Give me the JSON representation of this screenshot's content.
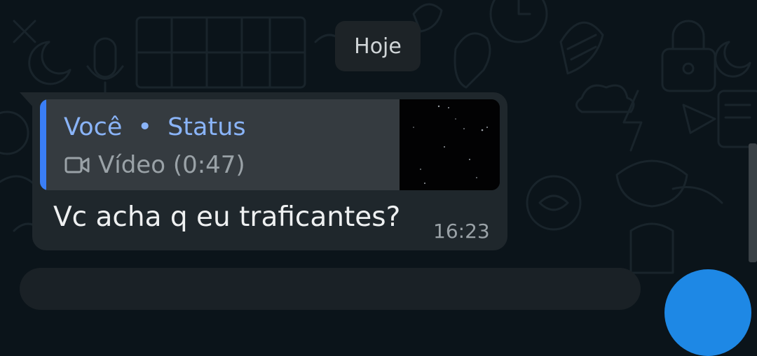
{
  "date_separator": "Hoje",
  "message": {
    "quote": {
      "author": "Você",
      "separator": "•",
      "source": "Status",
      "media_icon": "video-camera-icon",
      "media_label": "Vídeo (0:47)"
    },
    "text": "Vc acha q eu traficantes?",
    "time": "16:23"
  },
  "colors": {
    "background": "#0b141a",
    "bubble": "#1f272c",
    "quote_background": "#353b40",
    "quote_accent": "#3a7ef6",
    "quote_title": "#8ab4f8",
    "fab": "#1e88e5"
  }
}
